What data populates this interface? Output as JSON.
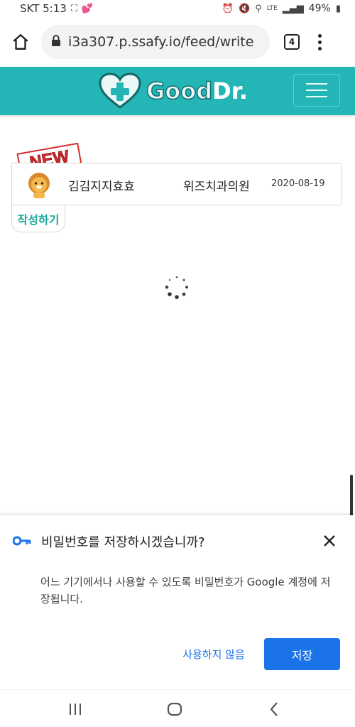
{
  "status_bar": {
    "carrier_time": "SKT 5:13",
    "battery": "49%",
    "network": "LTE"
  },
  "browser": {
    "url": "i3a307.p.ssafy.io/feed/write",
    "tab_count": "4"
  },
  "app": {
    "logo_good": "Good",
    "logo_dr": "Dr.",
    "brand_color": "#24b6b6"
  },
  "feed": {
    "new_badge": "NEW",
    "items": [
      {
        "author": "김김지지효효",
        "clinic": "위즈치과의원",
        "date": "2020-08-19"
      }
    ],
    "write_label": "작성하기"
  },
  "password_prompt": {
    "title": "비밀번호를 저장하시겠습니까?",
    "description": "어느 기기에서나 사용할 수 있도록 비밀번호가 Google 계정에 저장됩니다.",
    "never_label": "사용하지 않음",
    "save_label": "저장",
    "accent_color": "#1a73e8"
  }
}
